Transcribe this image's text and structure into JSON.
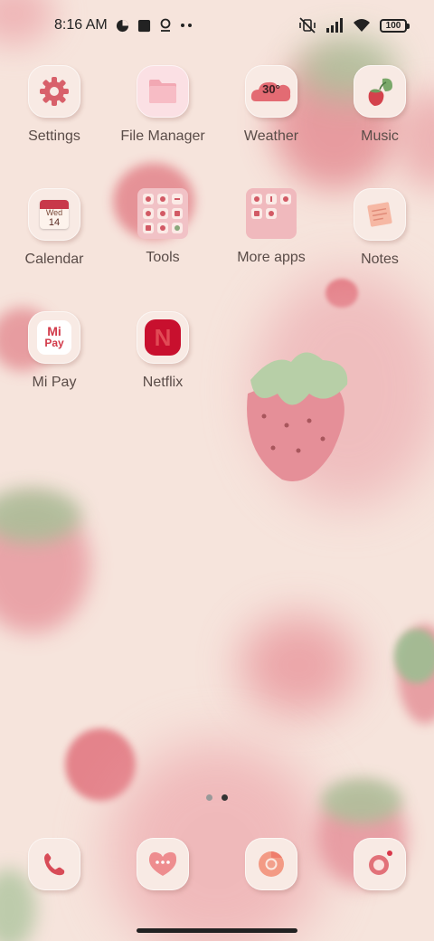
{
  "status_bar": {
    "time": "8:16 AM",
    "battery": "100",
    "left_icons": [
      "data-saver-icon",
      "square-icon",
      "location-icon",
      "more-dots-icon"
    ],
    "right_icons": [
      "mute-vibrate-icon",
      "signal-icon",
      "wifi-icon",
      "battery-icon"
    ]
  },
  "apps": {
    "settings": {
      "label": "Settings"
    },
    "file_manager": {
      "label": "File Manager"
    },
    "weather": {
      "label": "Weather",
      "temp": "30°"
    },
    "music": {
      "label": "Music"
    },
    "calendar": {
      "label": "Calendar",
      "day_name": "Wed",
      "day_num": "14"
    },
    "tools": {
      "label": "Tools"
    },
    "more_apps": {
      "label": "More apps"
    },
    "notes": {
      "label": "Notes"
    },
    "mi_pay": {
      "label": "Mi Pay",
      "line1": "Mi",
      "line2": "Pay"
    },
    "netflix": {
      "label": "Netflix",
      "glyph": "N"
    }
  },
  "dock": [
    {
      "name": "phone",
      "icon": "phone-icon"
    },
    {
      "name": "messages",
      "icon": "message-heart-icon"
    },
    {
      "name": "browser",
      "icon": "chrome-icon"
    },
    {
      "name": "camera",
      "icon": "camera-icon"
    }
  ],
  "pager": {
    "pages": 2,
    "current": 2
  },
  "colors": {
    "background": "#f6e4dc",
    "strawberry": "#e58f98",
    "leaf": "#9dbd92",
    "icon_tile": "#f8eae4",
    "accent": "#d6535f"
  }
}
